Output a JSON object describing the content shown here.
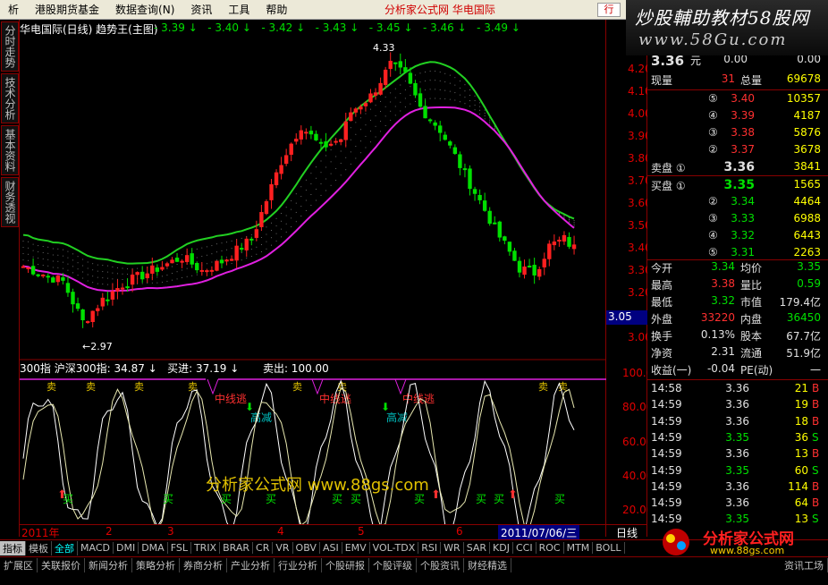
{
  "menu": {
    "items": [
      "析",
      "港股期货基金",
      "数据查询(N)",
      "资讯",
      "工具",
      "帮助"
    ],
    "center": "分析家公式网  华电国际",
    "right_btn": "行"
  },
  "banner": {
    "line1": "炒股輔助教材58股网",
    "line2": "www.58Gu.com"
  },
  "left_tabs": [
    "分时走势",
    "技术分析",
    "基本资料",
    "财务透视"
  ],
  "chart": {
    "title": "华电国际(日线) 趋势王(主图)",
    "ma_labels": [
      "- 3.39",
      "- 3.40",
      "- 3.42",
      "- 3.43",
      "- 3.45",
      "- 3.46",
      "- 3.49"
    ],
    "high_label": "4.33",
    "low_label": "2.97",
    "yticks": [
      "4.20",
      "4.10",
      "4.00",
      "3.90",
      "3.80",
      "3.70",
      "3.60",
      "3.50",
      "3.40",
      "3.30",
      "3.20",
      "3.10",
      "3.00"
    ],
    "current_price": "3.05"
  },
  "indicator": {
    "head": "300指 沪深300指: 34.87",
    "buy_in": "买进: 37.19",
    "sell_out": "卖出: 100.00",
    "yticks": [
      "100.0",
      "80.00",
      "60.00",
      "40.00",
      "20.00"
    ],
    "sell_label": "卖",
    "buy_label": "买",
    "mid_escape": "中线逃",
    "high_reduce": "高减"
  },
  "watermark": "分析家公式网  www.88gs.com",
  "xaxis": {
    "labels": [
      "2011年",
      "2",
      "3",
      "4",
      "5",
      "6"
    ],
    "date": "2011/07/06/三",
    "right": "日线"
  },
  "tabs": [
    "指标",
    "模板",
    "全部",
    "MACD",
    "DMI",
    "DMA",
    "FSL",
    "TRIX",
    "BRAR",
    "CR",
    "VR",
    "OBV",
    "ASI",
    "EMV",
    "VOL-TDX",
    "RSI",
    "WR",
    "SAR",
    "KDJ",
    "CCI",
    "ROC",
    "MTM",
    "BOLL"
  ],
  "bottom": [
    "扩展区",
    "关联报价",
    "新闻分析",
    "策略分析",
    "券商分析",
    "产业分析",
    "行业分析",
    "个股研报",
    "个股评级",
    "个股资讯",
    "财经精选",
    "资讯工场"
  ],
  "quote": {
    "price": "3.36",
    "unit": "元",
    "change": "0.00",
    "pct": "0.00",
    "vol_label": "现量",
    "vol": "31",
    "total_label": "总量",
    "total": "69678",
    "sells": [
      {
        "lvl": "⑤",
        "price": "3.40",
        "vol": "10357"
      },
      {
        "lvl": "④",
        "price": "3.39",
        "vol": "4187"
      },
      {
        "lvl": "③",
        "price": "3.38",
        "vol": "5876"
      },
      {
        "lvl": "②",
        "price": "3.37",
        "vol": "3678"
      },
      {
        "lvl": "卖盘 ①",
        "price": "3.36",
        "vol": "3841"
      }
    ],
    "buys": [
      {
        "lvl": "买盘 ①",
        "price": "3.35",
        "vol": "1565"
      },
      {
        "lvl": "②",
        "price": "3.34",
        "vol": "4464"
      },
      {
        "lvl": "③",
        "price": "3.33",
        "vol": "6988"
      },
      {
        "lvl": "④",
        "price": "3.32",
        "vol": "6443"
      },
      {
        "lvl": "⑤",
        "price": "3.31",
        "vol": "2263"
      }
    ],
    "stats": [
      {
        "l1": "今开",
        "v1": "3.34",
        "c1": "g",
        "l2": "均价",
        "v2": "3.35",
        "c2": "g"
      },
      {
        "l1": "最高",
        "v1": "3.38",
        "c1": "r",
        "l2": "量比",
        "v2": "0.59",
        "c2": "g"
      },
      {
        "l1": "最低",
        "v1": "3.32",
        "c1": "g",
        "l2": "市值",
        "v2": "179.4亿",
        "c2": "w"
      },
      {
        "l1": "外盘",
        "v1": "33220",
        "c1": "r",
        "l2": "内盘",
        "v2": "36450",
        "c2": "g"
      },
      {
        "l1": "换手",
        "v1": "0.13%",
        "c1": "w",
        "l2": "股本",
        "v2": "67.7亿",
        "c2": "w"
      },
      {
        "l1": "净资",
        "v1": "2.31",
        "c1": "w",
        "l2": "流通",
        "v2": "51.9亿",
        "c2": "w"
      },
      {
        "l1": "收益(一)",
        "v1": "-0.04",
        "c1": "w",
        "l2": "PE(动)",
        "v2": "一",
        "c2": "w"
      }
    ],
    "ticks": [
      {
        "t": "14:58",
        "p": "3.36",
        "v": "21",
        "s": "B"
      },
      {
        "t": "14:59",
        "p": "3.36",
        "v": "19",
        "s": "B"
      },
      {
        "t": "14:59",
        "p": "3.36",
        "v": "18",
        "s": "B"
      },
      {
        "t": "14:59",
        "p": "3.35",
        "v": "36",
        "s": "S"
      },
      {
        "t": "14:59",
        "p": "3.36",
        "v": "13",
        "s": "B"
      },
      {
        "t": "14:59",
        "p": "3.35",
        "v": "60",
        "s": "S"
      },
      {
        "t": "14:59",
        "p": "3.36",
        "v": "114",
        "s": "B"
      },
      {
        "t": "14:59",
        "p": "3.36",
        "v": "64",
        "s": "B"
      },
      {
        "t": "14:59",
        "p": "3.35",
        "v": "13",
        "s": "S"
      }
    ]
  },
  "logo": {
    "t1": "分析家公式网",
    "t2": "www.88gs.com"
  },
  "colors": {
    "up": "#ff2020",
    "down": "#00e000",
    "ma_green": "#22d022",
    "ma_pink": "#e020e0"
  }
}
